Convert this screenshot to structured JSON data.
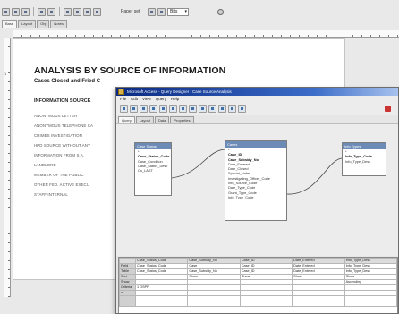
{
  "background_app": {
    "toolbar": {
      "font_name": "Paper set",
      "font_size": "Bits"
    },
    "tabs": [
      "Base",
      "Layout",
      "Obj",
      "Notes"
    ],
    "ruler_number": "1",
    "report": {
      "title": "ANALYSIS BY SOURCE OF INFORMATION",
      "subtitle": "Cases Closed and Fried C",
      "section": "INFORMATION SOURCE",
      "items": [
        "ANONYMOUS LETTER",
        "ANONYMOUS TELEPHONE CA",
        "CRIMES INVESTIGATION",
        "HPD SOURCE WITHOUT ANY",
        "INFORMATION FROM S.A.",
        "LANDLORD",
        "MEMBER OF THE PUBLIC",
        "OTHER FED. ACTIVE EXECU",
        "STAFF INTERNAL"
      ]
    }
  },
  "query_designer": {
    "title": "Microsoft Access - Query Designer : Case Source Analysis",
    "menu": [
      "File",
      "Edit",
      "View",
      "Query",
      "Help"
    ],
    "tabs": [
      "Query",
      "Layout",
      "Data",
      "Properties"
    ],
    "tables": [
      {
        "name": "Case Status",
        "fields": [
          "*",
          "Case_Status_Code",
          "Case_Condition",
          "Case_Status_Desc",
          "Co_LAST"
        ],
        "bold": [
          1
        ]
      },
      {
        "name": "Cases",
        "fields": [
          "*",
          "Case_ID",
          "Case_Subsidy_No",
          "Date_Entered",
          "Date_Closed",
          "Special_Notes",
          "Investigating_Officer_Code",
          "Info_Source_Code",
          "Date_Type_Code",
          "Grant_Type_Code",
          "Info_Type_Code"
        ],
        "bold": [
          1,
          2
        ]
      },
      {
        "name": "Info Types",
        "fields": [
          "*",
          "Info_Type_Code",
          "Info_Type_Desc"
        ],
        "bold": [
          1
        ]
      }
    ],
    "grid": {
      "row_labels": [
        "Field",
        "Table",
        "Sort",
        "Show",
        "Criteria",
        "or",
        "",
        ""
      ],
      "columns": [
        [
          "Case_Status_Code",
          "Case_Status_Code",
          "",
          "",
          "1 OSPP",
          "",
          "",
          ""
        ],
        [
          "Case",
          "Case_Subsidy_No",
          "Show",
          "",
          "",
          "",
          "",
          ""
        ],
        [
          "Case_ID",
          "Case_ID",
          "Show",
          "",
          "",
          "",
          "",
          ""
        ],
        [
          "Date_Entered",
          "Date_Entered",
          "Show",
          "",
          "",
          "",
          "",
          ""
        ],
        [
          "Info_Type_Desc",
          "Info_Type_Desc",
          "Show",
          "Ascending",
          "",
          "",
          "",
          ""
        ]
      ],
      "headers": [
        "Case_Status_Code",
        "Case_Subsidy_No",
        "Case_ID",
        "Date_Entered",
        "Info_Type_Desc"
      ]
    }
  }
}
